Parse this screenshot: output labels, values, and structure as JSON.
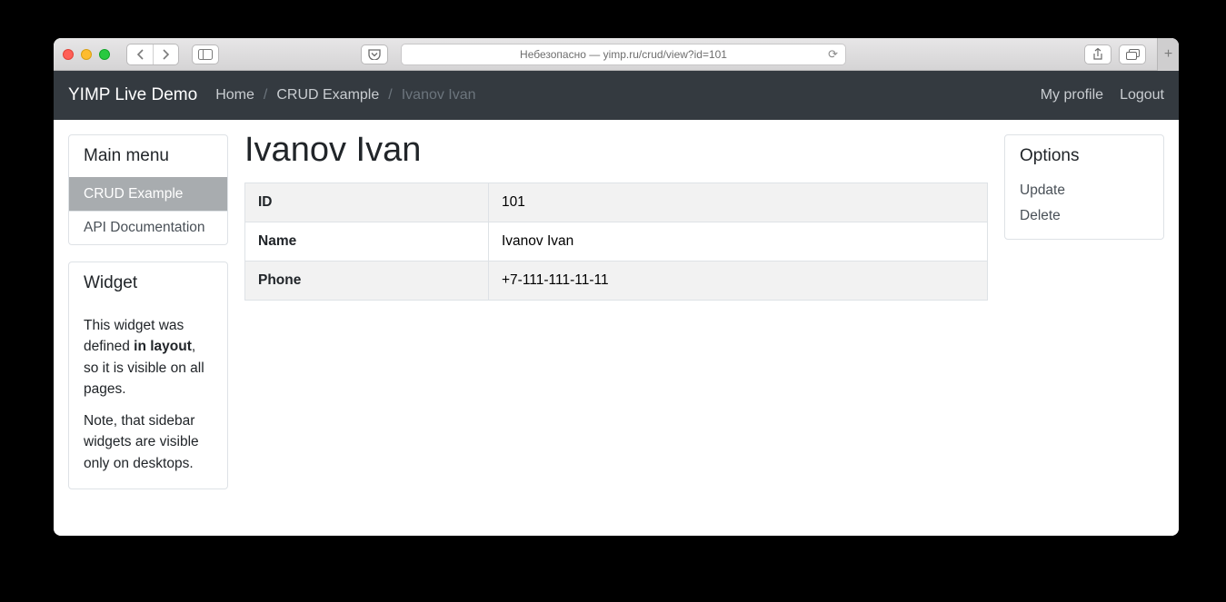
{
  "browser": {
    "url_text": "Небезопасно — yimp.ru/crud/view?id=101"
  },
  "navbar": {
    "brand": "YIMP Live Demo",
    "breadcrumb": {
      "home": "Home",
      "crud": "CRUD Example",
      "current": "Ivanov Ivan"
    },
    "right": {
      "profile": "My profile",
      "logout": "Logout"
    }
  },
  "sidebar": {
    "header": "Main menu",
    "items": [
      {
        "label": "CRUD Example",
        "active": true
      },
      {
        "label": "API Documentation",
        "active": false
      }
    ]
  },
  "widget": {
    "header": "Widget",
    "p1_a": "This widget was defined ",
    "p1_strong": "in layout",
    "p1_b": ", so it is visible on all pages.",
    "p2": "Note, that sidebar widgets are visible only on desktops."
  },
  "page": {
    "title": "Ivanov Ivan",
    "rows": [
      {
        "label": "ID",
        "value": "101"
      },
      {
        "label": "Name",
        "value": "Ivanov Ivan"
      },
      {
        "label": "Phone",
        "value": "+7-111-111-11-11"
      }
    ]
  },
  "options": {
    "header": "Options",
    "items": [
      {
        "label": "Update"
      },
      {
        "label": "Delete"
      }
    ]
  }
}
